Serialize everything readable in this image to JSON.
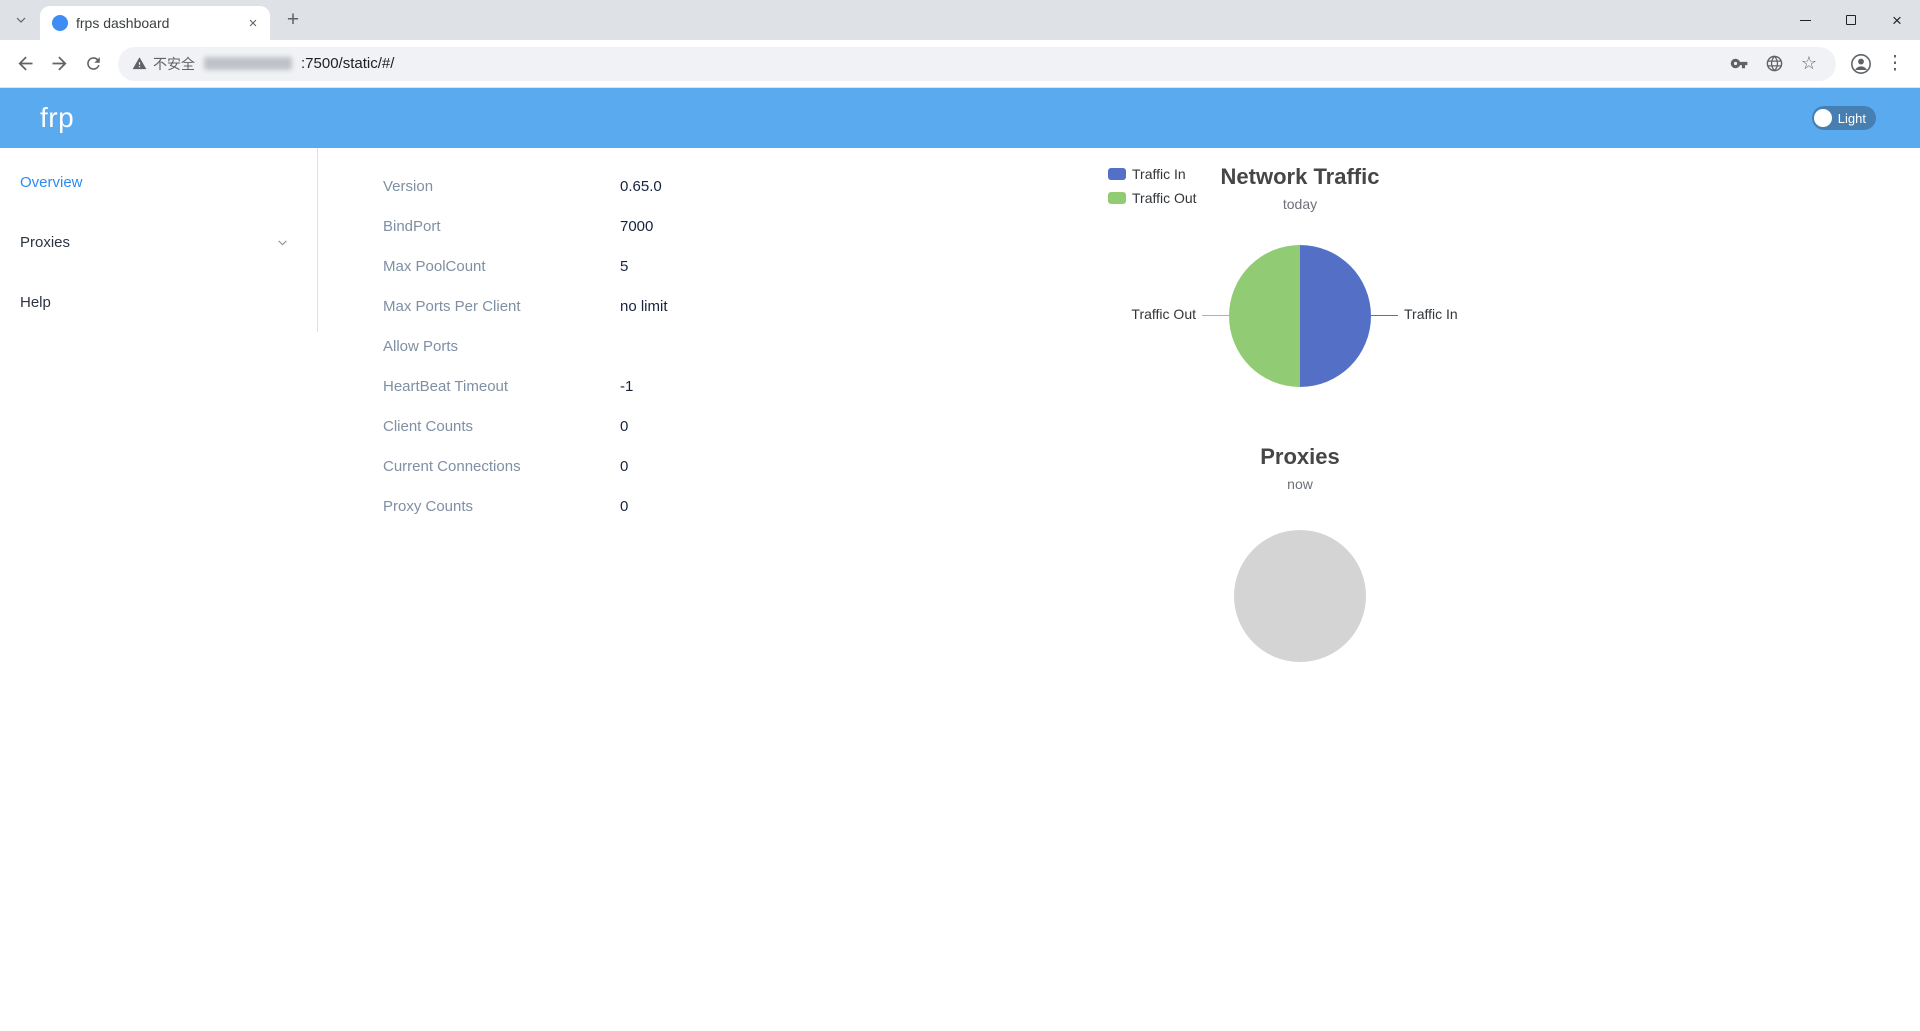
{
  "colors": {
    "header_bg": "#5aaaf0",
    "sidebar_active": "#2d8cf0",
    "favicon_blue": "#3d8df5",
    "traffic_in": "#5470c6",
    "traffic_out": "#91cc75",
    "empty_pie": "#d4d4d4"
  },
  "icons": {
    "close": "×",
    "new_tab": "+",
    "star": "☆",
    "overflow_menu": "⋮"
  },
  "browser": {
    "tab_title": "frps dashboard",
    "security_label": "不安全",
    "url_path": ":7500/static/#/"
  },
  "header": {
    "brand": "frp",
    "theme_label": "Light"
  },
  "sidebar": {
    "items": [
      {
        "label": "Overview"
      },
      {
        "label": "Proxies"
      },
      {
        "label": "Help"
      }
    ]
  },
  "overview": {
    "rows": [
      {
        "label": "Version",
        "value": "0.65.0"
      },
      {
        "label": "BindPort",
        "value": "7000"
      },
      {
        "label": "Max PoolCount",
        "value": "5"
      },
      {
        "label": "Max Ports Per Client",
        "value": "no limit"
      },
      {
        "label": "Allow Ports",
        "value": ""
      },
      {
        "label": "HeartBeat Timeout",
        "value": "-1"
      },
      {
        "label": "Client Counts",
        "value": "0"
      },
      {
        "label": "Current Connections",
        "value": "0"
      },
      {
        "label": "Proxy Counts",
        "value": "0"
      }
    ]
  },
  "chart_data": [
    {
      "type": "pie",
      "title": "Network Traffic",
      "subtitle": "today",
      "legend": [
        "Traffic In",
        "Traffic Out"
      ],
      "legend_position": "top-left",
      "slices": [
        {
          "label": "Traffic In",
          "value": 50,
          "color": "#5470c6"
        },
        {
          "label": "Traffic Out",
          "value": 50,
          "color": "#91cc75"
        }
      ]
    },
    {
      "type": "pie",
      "title": "Proxies",
      "subtitle": "now",
      "legend": [],
      "slices": [
        {
          "label": "",
          "value": 100,
          "color": "#d4d4d4"
        }
      ]
    }
  ]
}
